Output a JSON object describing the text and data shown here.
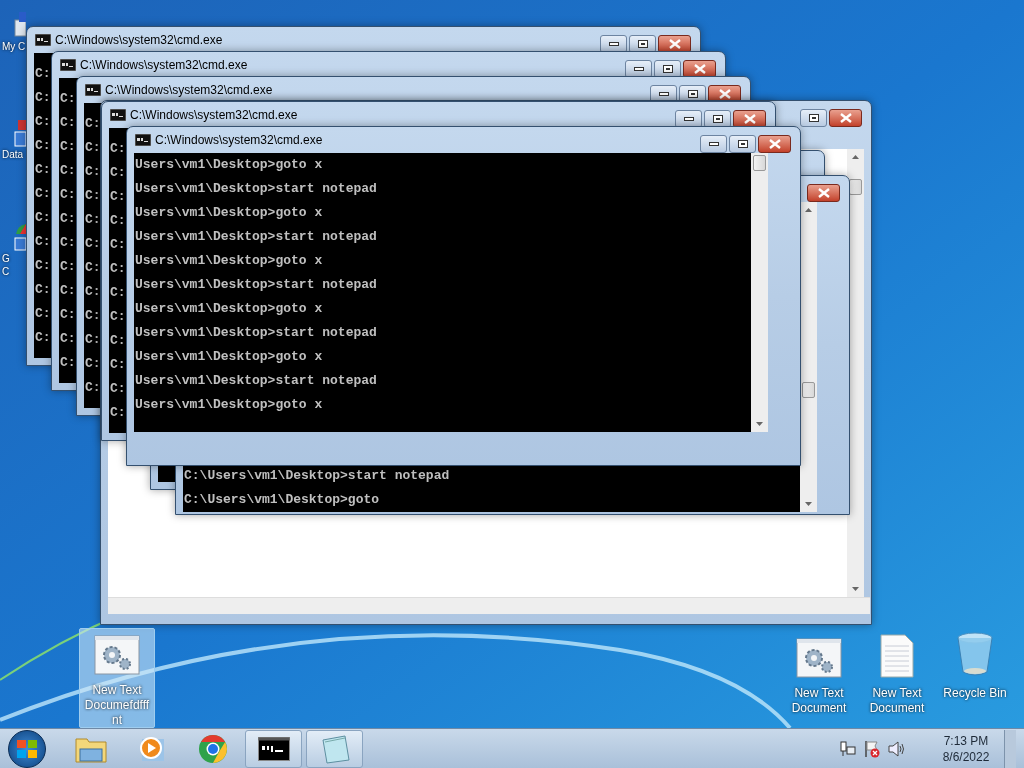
{
  "desktop_icons_left": [
    {
      "kind": "computer",
      "label_lines": [
        "My C"
      ]
    },
    {
      "kind": "shortcut",
      "label_lines": [
        "Data"
      ]
    },
    {
      "kind": "chrome",
      "label_lines": [
        "G",
        "C"
      ]
    }
  ],
  "windows": [
    {
      "kind": "console",
      "title": "C:\\Windows\\system32\\cmd.exe",
      "lines": [
        "C:",
        "C:",
        "C:",
        "C:",
        "C:",
        "C:",
        "C:",
        "C:",
        "C:",
        "C:",
        "C:",
        "C:"
      ]
    },
    {
      "kind": "console",
      "title": "C:\\Windows\\system32\\cmd.exe",
      "lines": [
        "C:",
        "C:",
        "C:",
        "C:",
        "C:",
        "C:",
        "C:",
        "C:",
        "C:",
        "C:",
        "C:",
        "C:"
      ]
    },
    {
      "kind": "console",
      "title": "C:\\Windows\\system32\\cmd.exe",
      "lines": [
        "C:",
        "C:",
        "C:",
        "C:",
        "C:",
        "C:",
        "C:",
        "C:",
        "C:",
        "C:",
        "C:",
        "C:"
      ]
    },
    {
      "kind": "blank"
    },
    {
      "kind": "console"
    },
    {
      "kind": "console",
      "lines": [
        "C:\\Users\\vm1\\Desktop>start notepad",
        "C:\\Users\\vm1\\Desktop>goto"
      ]
    },
    {
      "kind": "console",
      "title": "C:\\Windows\\system32\\cmd.exe",
      "lines": [
        "C:",
        "C:",
        "C:",
        "C:",
        "C:",
        "C:",
        "C:",
        "C:",
        "C:",
        "C:",
        "C:",
        "C:"
      ]
    },
    {
      "kind": "console",
      "title": "C:\\Windows\\system32\\cmd.exe",
      "lines": [
        "Users\\vm1\\Desktop>goto x",
        "Users\\vm1\\Desktop>start notepad",
        "Users\\vm1\\Desktop>goto x",
        "Users\\vm1\\Desktop>start notepad",
        "Users\\vm1\\Desktop>goto x",
        "Users\\vm1\\Desktop>start notepad",
        "Users\\vm1\\Desktop>goto x",
        "Users\\vm1\\Desktop>start notepad",
        "Users\\vm1\\Desktop>goto x",
        "Users\\vm1\\Desktop>start notepad",
        "Users\\vm1\\Desktop>goto x"
      ]
    }
  ],
  "desktop_icons": [
    {
      "kind": "settings-doc",
      "label_lines": [
        "New Text",
        "Documefdfff",
        "nt"
      ],
      "selected": true
    },
    {
      "kind": "settings-doc",
      "label_lines": [
        "New Text",
        "Document"
      ],
      "selected": false
    },
    {
      "kind": "text-doc",
      "label_lines": [
        "New Text",
        "Document"
      ],
      "selected": false
    },
    {
      "kind": "recycle-bin",
      "label_lines": [
        "Recycle Bin"
      ],
      "selected": false
    }
  ],
  "taskbar": {
    "items": [
      {
        "kind": "explorer",
        "open": false
      },
      {
        "kind": "media",
        "open": false
      },
      {
        "kind": "chrome",
        "open": false
      },
      {
        "kind": "console",
        "open": true
      },
      {
        "kind": "notepad",
        "open": true
      }
    ],
    "tray": [
      {
        "kind": "network"
      },
      {
        "kind": "flag"
      },
      {
        "kind": "volume"
      }
    ],
    "clock": {
      "time": "7:13 PM",
      "date": "8/6/2022"
    }
  }
}
